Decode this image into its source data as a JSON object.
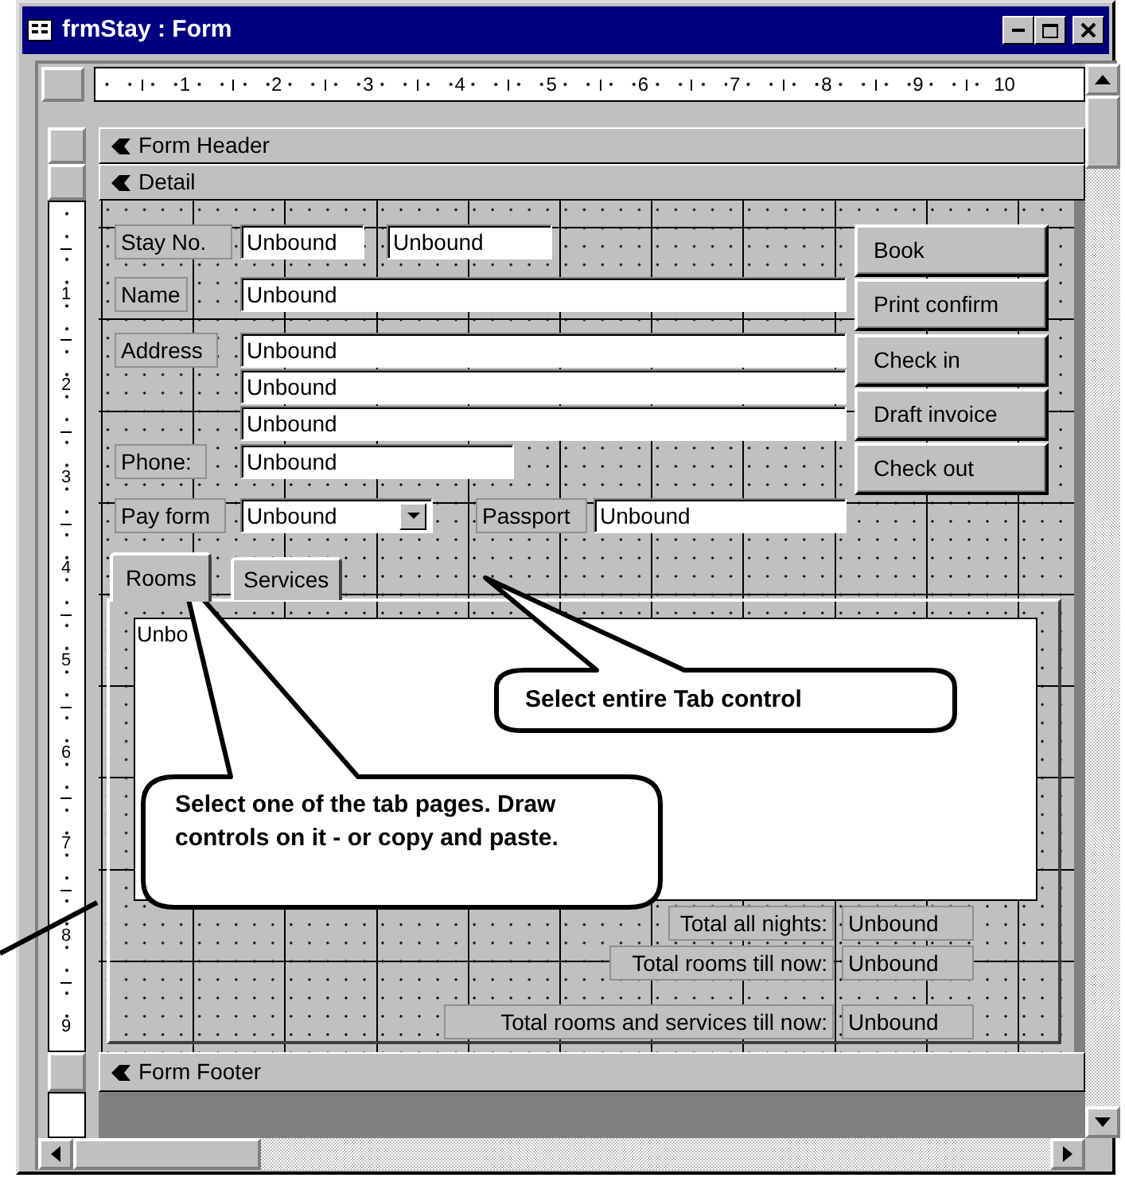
{
  "window": {
    "title": "frmStay : Form"
  },
  "ruler": {
    "horizontal": [
      "1",
      "2",
      "3",
      "4",
      "5",
      "6",
      "7",
      "8",
      "9",
      "10"
    ],
    "vertical": [
      "1",
      "2",
      "3",
      "4",
      "5",
      "6",
      "7",
      "8",
      "9"
    ]
  },
  "form_header": {
    "label": "Form Header"
  },
  "detail": {
    "label": "Detail",
    "controls": [
      {
        "kind": "label",
        "text": "Stay No."
      },
      {
        "kind": "textbox",
        "value": "Unbound"
      },
      {
        "kind": "textbox",
        "value": "Unbound"
      },
      {
        "kind": "label",
        "text": "Name"
      },
      {
        "kind": "textbox",
        "value": "Unbound"
      },
      {
        "kind": "label",
        "text": "Address"
      },
      {
        "kind": "textbox",
        "value": "Unbound"
      },
      {
        "kind": "textbox",
        "value": "Unbound"
      },
      {
        "kind": "textbox",
        "value": "Unbound"
      },
      {
        "kind": "label",
        "text": "Phone:"
      },
      {
        "kind": "textbox",
        "value": "Unbound"
      },
      {
        "kind": "label",
        "text": "Pay form"
      },
      {
        "kind": "combobox",
        "value": "Unbound"
      },
      {
        "kind": "label",
        "text": "Passport"
      },
      {
        "kind": "textbox",
        "value": "Unbound"
      }
    ],
    "buttons": [
      {
        "label": "Book"
      },
      {
        "label": "Print confirm"
      },
      {
        "label": "Check in"
      },
      {
        "label": "Draft invoice"
      },
      {
        "label": "Check out"
      }
    ],
    "tab_control": {
      "tabs": [
        {
          "label": "Rooms",
          "selected": true
        },
        {
          "label": "Services",
          "selected": false
        }
      ],
      "listbox": {
        "value": "Unbo"
      }
    },
    "totals": [
      {
        "label": "Total all nights:",
        "value": "Unbound"
      },
      {
        "label": "Total rooms till now:",
        "value": "Unbound"
      },
      {
        "label": "Total rooms and services till now:",
        "value": "Unbound"
      }
    ]
  },
  "form_footer": {
    "label": "Form Footer"
  },
  "callouts": [
    {
      "text": "Select entire Tab control"
    },
    {
      "text": "Select one of the tab pages. Draw controls on it - or copy and paste."
    }
  ]
}
